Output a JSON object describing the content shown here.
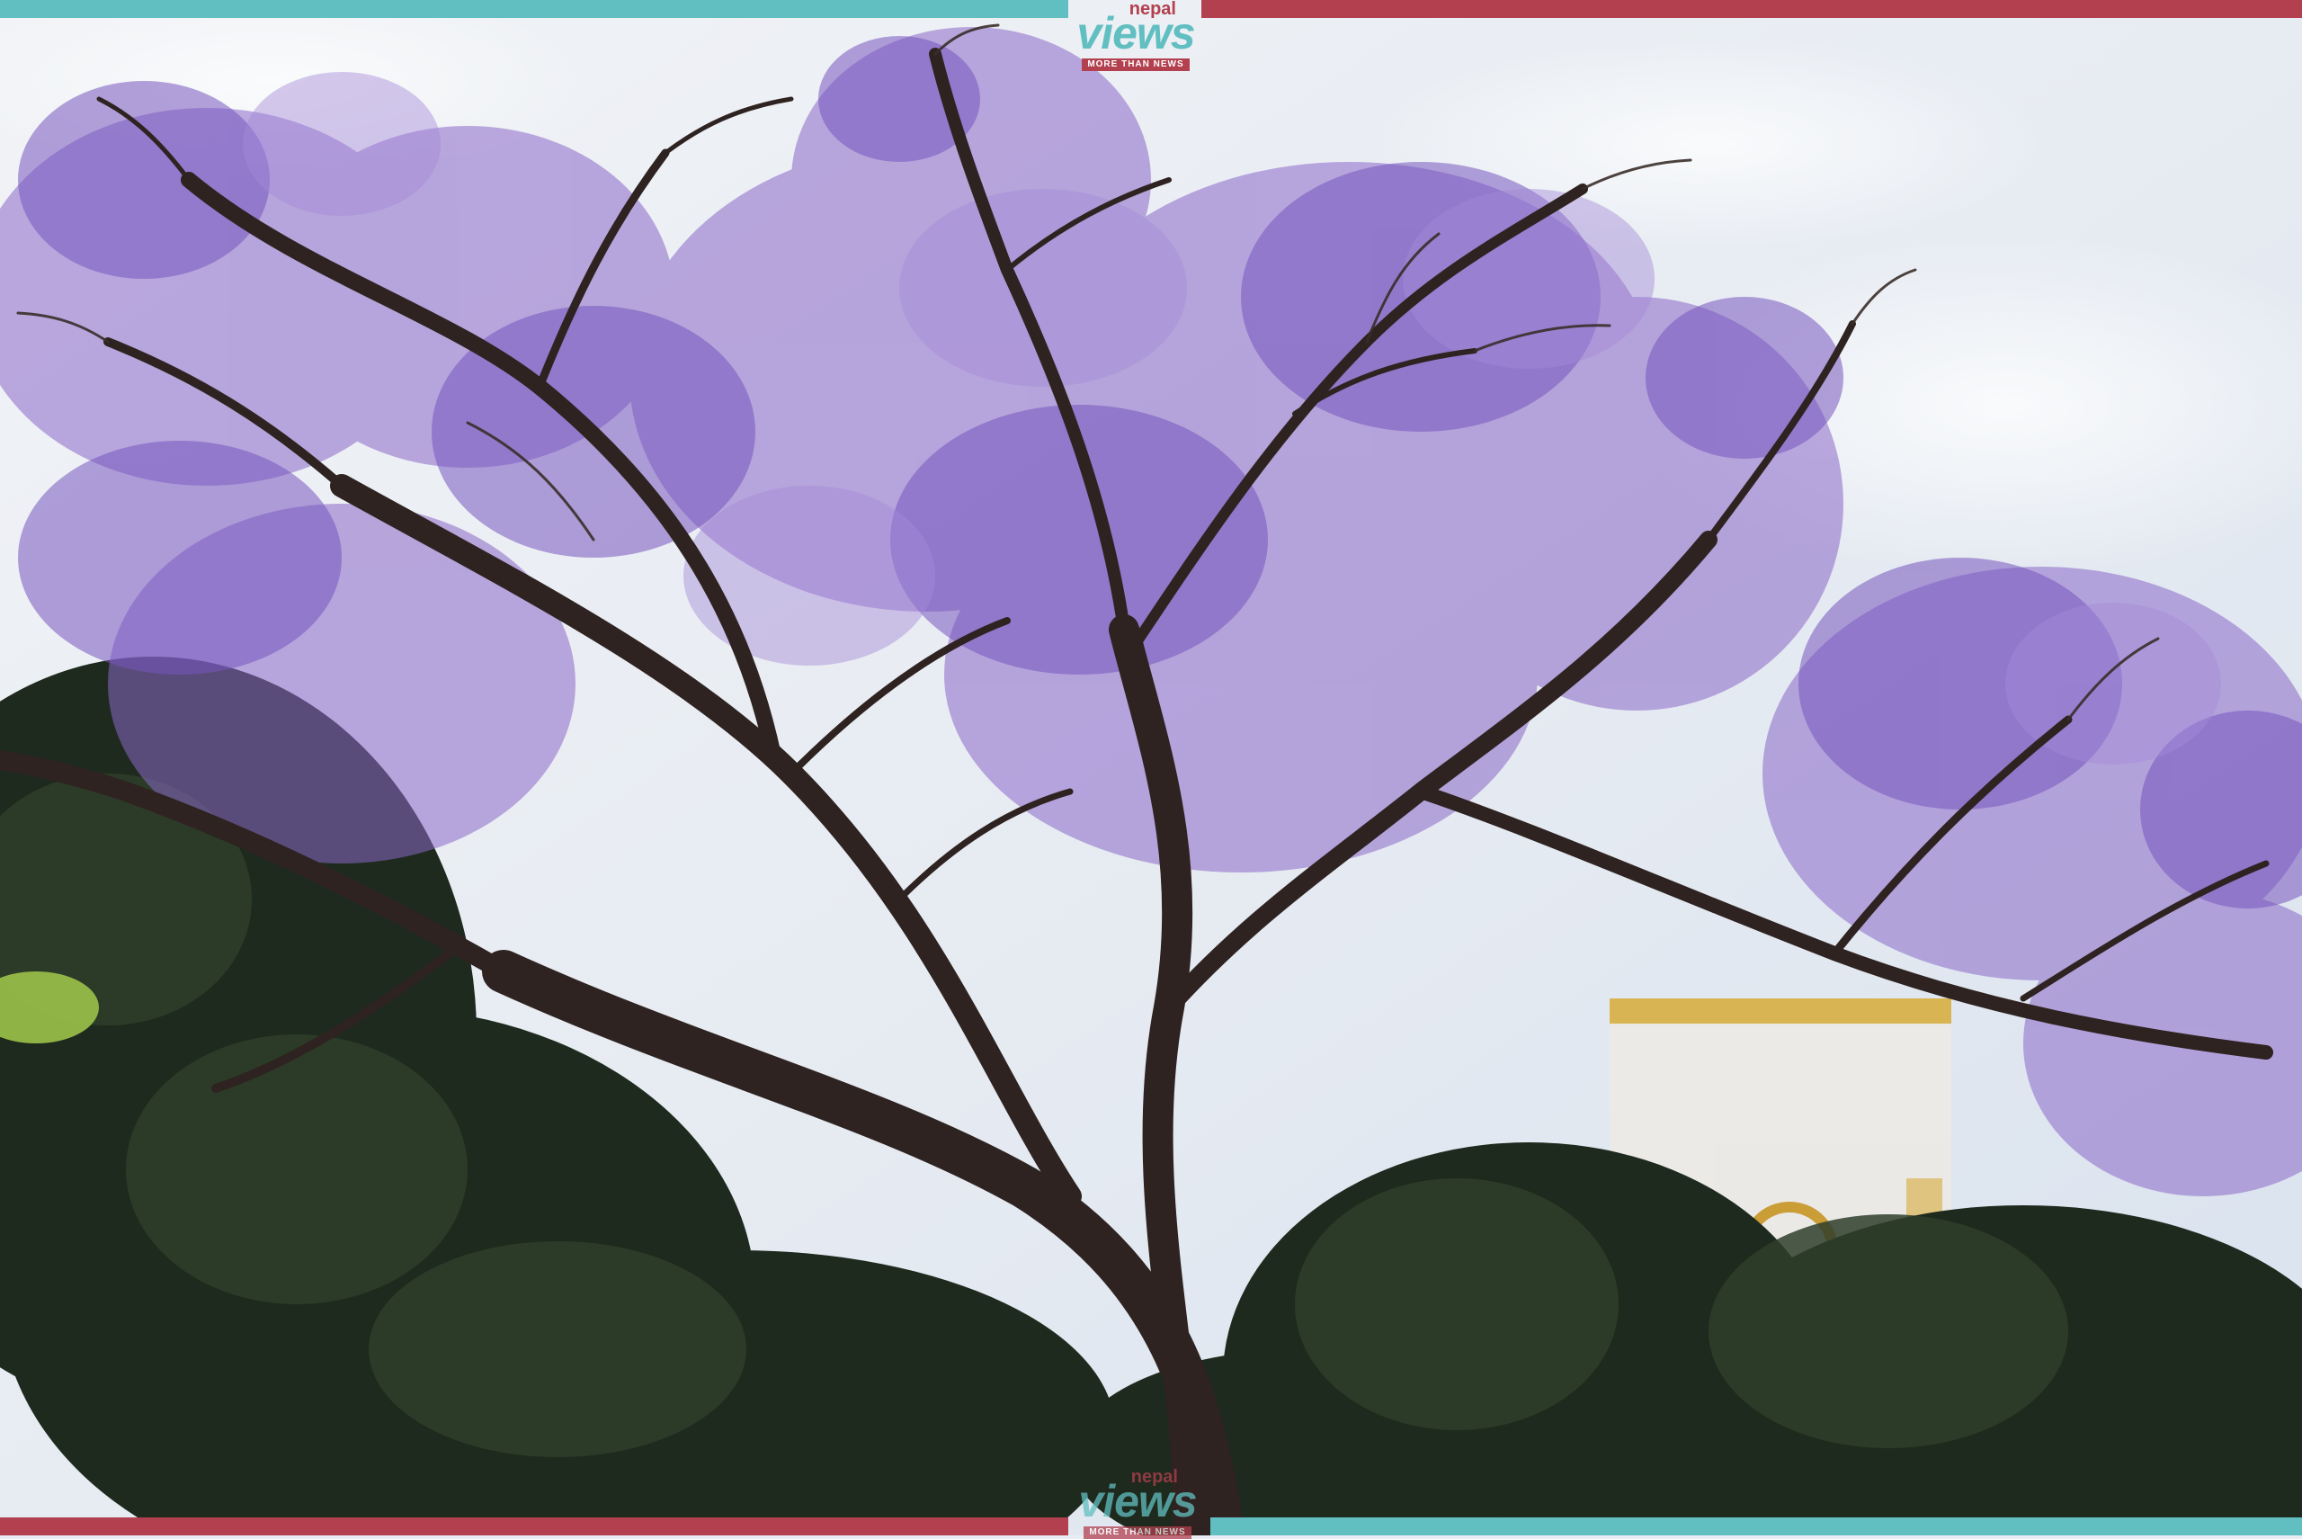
{
  "brand": {
    "small": "nepal",
    "main": "views",
    "tagline": "MORE THAN NEWS"
  },
  "colors": {
    "teal": "#62bfc1",
    "crimson": "#b2404f",
    "sky": "#e8edf4",
    "blossom": "#8a68c8",
    "branch": "#2e2320"
  },
  "photo": {
    "subject": "jacaranda tree in bloom against a cloudy sky"
  }
}
